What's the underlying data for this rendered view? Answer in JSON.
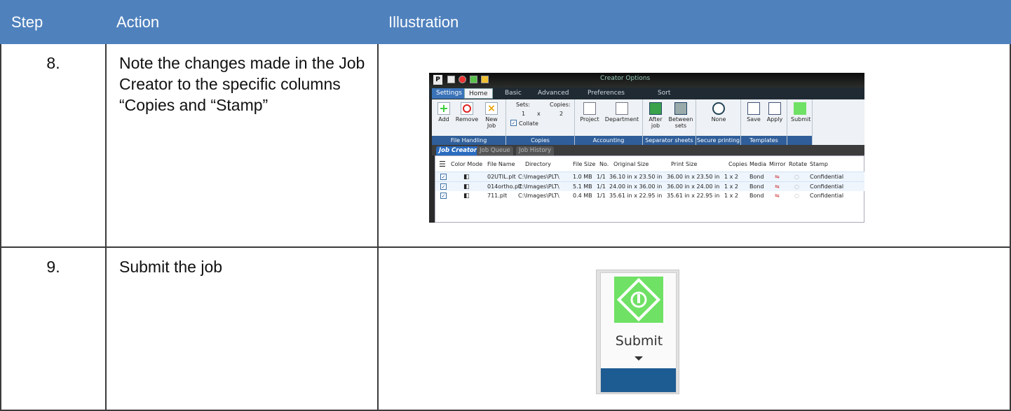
{
  "table": {
    "headers": [
      "Step",
      "Action",
      "Illustration"
    ],
    "rows": [
      {
        "step": "8.",
        "action": "Note the changes made in the Job Creator to the specific columns “Copies and “Stamp”"
      },
      {
        "step": "9.",
        "action": "Submit the job"
      }
    ]
  },
  "job_creator": {
    "window_title": "Creator Options",
    "tabs": [
      "Settings",
      "Home",
      "Basic",
      "Advanced",
      "Preferences",
      "Sort"
    ],
    "ribbon": {
      "file_handling": {
        "label": "File Handling",
        "buttons": [
          "Add",
          "Remove",
          "New Job"
        ]
      },
      "copies": {
        "label": "Copies",
        "sets_label": "Sets:",
        "copies_label": "Copies:",
        "sets_value": "1",
        "x": "x",
        "copies_value": "2",
        "collate_label": "Collate"
      },
      "accounting": {
        "label": "Accounting",
        "buttons": [
          "Project",
          "Department"
        ]
      },
      "separator": {
        "label": "Separator sheets",
        "buttons": [
          "After job",
          "Between sets"
        ]
      },
      "secure": {
        "label": "Secure printing",
        "buttons": [
          "None"
        ]
      },
      "templates": {
        "label": "Templates",
        "buttons": [
          "Save",
          "Apply"
        ]
      },
      "submit": {
        "label": "Submit"
      }
    },
    "subtabs": [
      "Job Creator",
      "Job Queue",
      "Job History"
    ],
    "columns": [
      "Color Mode",
      "File Name",
      "Directory",
      "File Size",
      "No.",
      "Original Size",
      "Print Size",
      "Copies",
      "Media",
      "Mirror",
      "Rotate",
      "Stamp"
    ],
    "rows": [
      [
        "02UTIL.plt",
        "C:\\Images\\PLT\\",
        "1.0 MB",
        "1/1",
        "36.10 in x 23.50 in",
        "36.00 in x 23.50 in",
        "1 x 2",
        "Bond",
        "Confidential"
      ],
      [
        "014ortho.plt",
        "C:\\Images\\PLT\\",
        "5.1 MB",
        "1/1",
        "24.00 in x 36.00 in",
        "36.00 in x 24.00 in",
        "1 x 2",
        "Bond",
        "Confidential"
      ],
      [
        "711.plt",
        "C:\\Images\\PLT\\",
        "0.4 MB",
        "1/1",
        "35.61 in x 22.95 in",
        "35.61 in x 22.95 in",
        "1 x 2",
        "Bond",
        "Confidential"
      ]
    ]
  },
  "submit_zoom": {
    "label": "Submit"
  },
  "colors": {
    "header_bg": "#4f81bd",
    "submit_green": "#6fe165",
    "ribbon_blue": "#2f5e9a"
  }
}
